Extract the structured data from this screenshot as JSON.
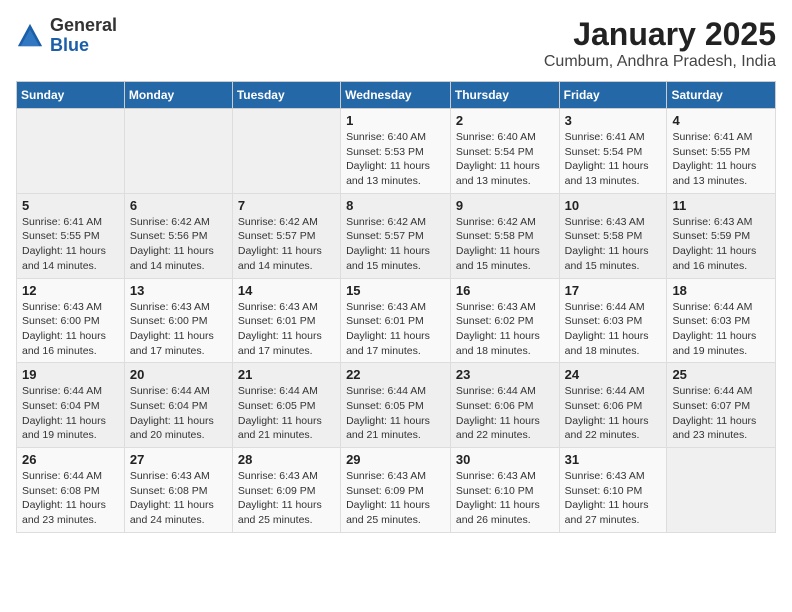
{
  "header": {
    "logo_general": "General",
    "logo_blue": "Blue",
    "title": "January 2025",
    "subtitle": "Cumbum, Andhra Pradesh, India"
  },
  "weekdays": [
    "Sunday",
    "Monday",
    "Tuesday",
    "Wednesday",
    "Thursday",
    "Friday",
    "Saturday"
  ],
  "weeks": [
    [
      {
        "day": "",
        "info": ""
      },
      {
        "day": "",
        "info": ""
      },
      {
        "day": "",
        "info": ""
      },
      {
        "day": "1",
        "info": "Sunrise: 6:40 AM\nSunset: 5:53 PM\nDaylight: 11 hours\nand 13 minutes."
      },
      {
        "day": "2",
        "info": "Sunrise: 6:40 AM\nSunset: 5:54 PM\nDaylight: 11 hours\nand 13 minutes."
      },
      {
        "day": "3",
        "info": "Sunrise: 6:41 AM\nSunset: 5:54 PM\nDaylight: 11 hours\nand 13 minutes."
      },
      {
        "day": "4",
        "info": "Sunrise: 6:41 AM\nSunset: 5:55 PM\nDaylight: 11 hours\nand 13 minutes."
      }
    ],
    [
      {
        "day": "5",
        "info": "Sunrise: 6:41 AM\nSunset: 5:55 PM\nDaylight: 11 hours\nand 14 minutes."
      },
      {
        "day": "6",
        "info": "Sunrise: 6:42 AM\nSunset: 5:56 PM\nDaylight: 11 hours\nand 14 minutes."
      },
      {
        "day": "7",
        "info": "Sunrise: 6:42 AM\nSunset: 5:57 PM\nDaylight: 11 hours\nand 14 minutes."
      },
      {
        "day": "8",
        "info": "Sunrise: 6:42 AM\nSunset: 5:57 PM\nDaylight: 11 hours\nand 15 minutes."
      },
      {
        "day": "9",
        "info": "Sunrise: 6:42 AM\nSunset: 5:58 PM\nDaylight: 11 hours\nand 15 minutes."
      },
      {
        "day": "10",
        "info": "Sunrise: 6:43 AM\nSunset: 5:58 PM\nDaylight: 11 hours\nand 15 minutes."
      },
      {
        "day": "11",
        "info": "Sunrise: 6:43 AM\nSunset: 5:59 PM\nDaylight: 11 hours\nand 16 minutes."
      }
    ],
    [
      {
        "day": "12",
        "info": "Sunrise: 6:43 AM\nSunset: 6:00 PM\nDaylight: 11 hours\nand 16 minutes."
      },
      {
        "day": "13",
        "info": "Sunrise: 6:43 AM\nSunset: 6:00 PM\nDaylight: 11 hours\nand 17 minutes."
      },
      {
        "day": "14",
        "info": "Sunrise: 6:43 AM\nSunset: 6:01 PM\nDaylight: 11 hours\nand 17 minutes."
      },
      {
        "day": "15",
        "info": "Sunrise: 6:43 AM\nSunset: 6:01 PM\nDaylight: 11 hours\nand 17 minutes."
      },
      {
        "day": "16",
        "info": "Sunrise: 6:43 AM\nSunset: 6:02 PM\nDaylight: 11 hours\nand 18 minutes."
      },
      {
        "day": "17",
        "info": "Sunrise: 6:44 AM\nSunset: 6:03 PM\nDaylight: 11 hours\nand 18 minutes."
      },
      {
        "day": "18",
        "info": "Sunrise: 6:44 AM\nSunset: 6:03 PM\nDaylight: 11 hours\nand 19 minutes."
      }
    ],
    [
      {
        "day": "19",
        "info": "Sunrise: 6:44 AM\nSunset: 6:04 PM\nDaylight: 11 hours\nand 19 minutes."
      },
      {
        "day": "20",
        "info": "Sunrise: 6:44 AM\nSunset: 6:04 PM\nDaylight: 11 hours\nand 20 minutes."
      },
      {
        "day": "21",
        "info": "Sunrise: 6:44 AM\nSunset: 6:05 PM\nDaylight: 11 hours\nand 21 minutes."
      },
      {
        "day": "22",
        "info": "Sunrise: 6:44 AM\nSunset: 6:05 PM\nDaylight: 11 hours\nand 21 minutes."
      },
      {
        "day": "23",
        "info": "Sunrise: 6:44 AM\nSunset: 6:06 PM\nDaylight: 11 hours\nand 22 minutes."
      },
      {
        "day": "24",
        "info": "Sunrise: 6:44 AM\nSunset: 6:06 PM\nDaylight: 11 hours\nand 22 minutes."
      },
      {
        "day": "25",
        "info": "Sunrise: 6:44 AM\nSunset: 6:07 PM\nDaylight: 11 hours\nand 23 minutes."
      }
    ],
    [
      {
        "day": "26",
        "info": "Sunrise: 6:44 AM\nSunset: 6:08 PM\nDaylight: 11 hours\nand 23 minutes."
      },
      {
        "day": "27",
        "info": "Sunrise: 6:43 AM\nSunset: 6:08 PM\nDaylight: 11 hours\nand 24 minutes."
      },
      {
        "day": "28",
        "info": "Sunrise: 6:43 AM\nSunset: 6:09 PM\nDaylight: 11 hours\nand 25 minutes."
      },
      {
        "day": "29",
        "info": "Sunrise: 6:43 AM\nSunset: 6:09 PM\nDaylight: 11 hours\nand 25 minutes."
      },
      {
        "day": "30",
        "info": "Sunrise: 6:43 AM\nSunset: 6:10 PM\nDaylight: 11 hours\nand 26 minutes."
      },
      {
        "day": "31",
        "info": "Sunrise: 6:43 AM\nSunset: 6:10 PM\nDaylight: 11 hours\nand 27 minutes."
      },
      {
        "day": "",
        "info": ""
      }
    ]
  ]
}
